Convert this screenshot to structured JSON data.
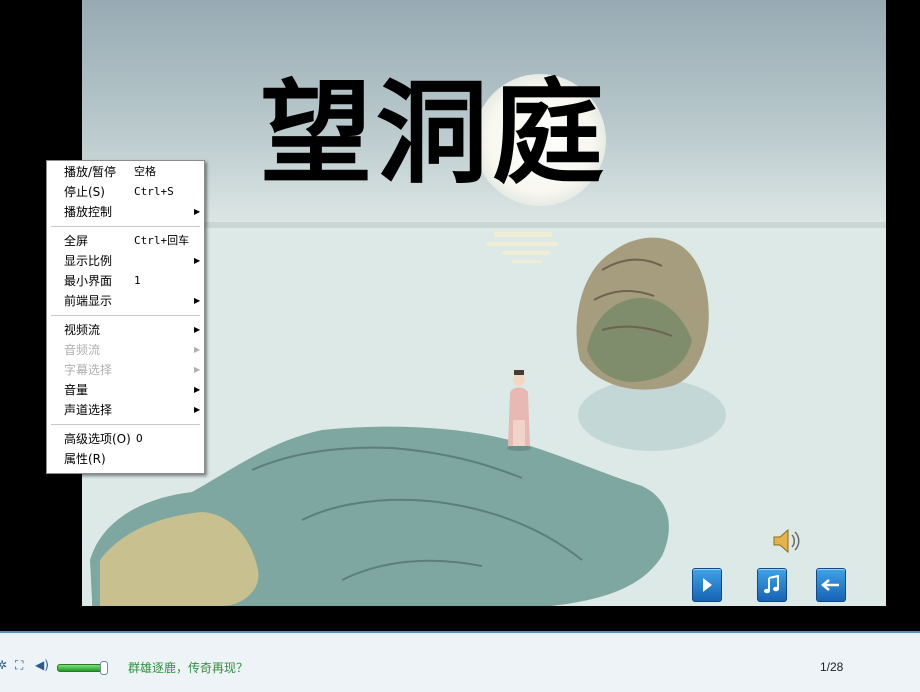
{
  "slide": {
    "title": "望洞庭",
    "page_indicator": "1/28"
  },
  "nav_buttons": [
    {
      "name": "play-next-button",
      "icon": "play-triangle-icon"
    },
    {
      "name": "music-button",
      "icon": "music-note-icon"
    },
    {
      "name": "back-button",
      "icon": "back-arrow-icon"
    }
  ],
  "context_menu": {
    "groups": [
      [
        {
          "label": "播放/暂停",
          "shortcut": "空格",
          "submenu": false,
          "disabled": false
        },
        {
          "label": "停止(S)",
          "shortcut": "Ctrl+S",
          "submenu": false,
          "disabled": false
        },
        {
          "label": "播放控制",
          "shortcut": "",
          "submenu": true,
          "disabled": false
        }
      ],
      [
        {
          "label": "全屏",
          "shortcut": "Ctrl+回车",
          "submenu": false,
          "disabled": false
        },
        {
          "label": "显示比例",
          "shortcut": "",
          "submenu": true,
          "disabled": false
        },
        {
          "label": "最小界面",
          "shortcut": "1",
          "submenu": false,
          "disabled": false
        },
        {
          "label": "前端显示",
          "shortcut": "",
          "submenu": true,
          "disabled": false
        }
      ],
      [
        {
          "label": "视频流",
          "shortcut": "",
          "submenu": true,
          "disabled": false
        },
        {
          "label": "音频流",
          "shortcut": "",
          "submenu": true,
          "disabled": true
        },
        {
          "label": "字幕选择",
          "shortcut": "",
          "submenu": true,
          "disabled": true
        },
        {
          "label": "音量",
          "shortcut": "",
          "submenu": true,
          "disabled": false
        },
        {
          "label": "声道选择",
          "shortcut": "",
          "submenu": true,
          "disabled": false
        }
      ],
      [
        {
          "label": "高级选项(O)",
          "shortcut": "O",
          "submenu": false,
          "disabled": false
        },
        {
          "label": "属性(R)",
          "shortcut": "",
          "submenu": false,
          "disabled": false
        }
      ]
    ]
  },
  "statusbar": {
    "marquee_text": "群雄逐鹿，传奇再现？",
    "volume_level": 0.9
  },
  "colors": {
    "sky_top": "#97aab3",
    "water": "#dde9e7",
    "nav_button": "#1f7cd0",
    "marquee": "#2f8f3f",
    "statusbar_border": "#5c8dbd"
  }
}
